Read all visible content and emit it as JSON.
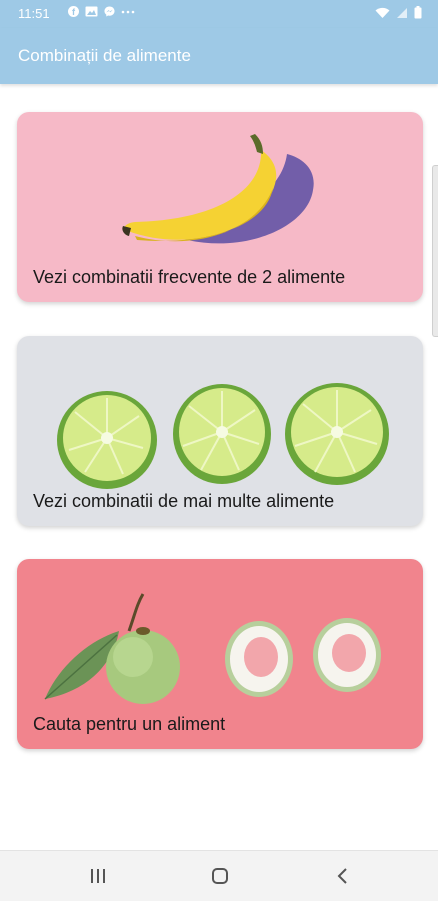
{
  "status_bar": {
    "time": "11:51",
    "notification_icons": [
      "facebook-icon",
      "gallery-icon",
      "messenger-icon",
      "more-dots-icon"
    ],
    "system_icons": [
      "wifi-icon",
      "signal-icon",
      "battery-icon"
    ]
  },
  "app_bar": {
    "title": "Combinații de alimente"
  },
  "cards": [
    {
      "label": "Vezi combinatii frecvente de 2 alimente",
      "image": "banana",
      "background": "#f6b9c7"
    },
    {
      "label": "Vezi combinatii de mai multe alimente",
      "image": "limes",
      "background": "#dfe1e6"
    },
    {
      "label": "Cauta pentru un aliment",
      "image": "guavas",
      "background": "#f1848d"
    }
  ],
  "nav_bar": {
    "buttons": [
      "recents-icon",
      "home-icon",
      "back-icon"
    ]
  }
}
